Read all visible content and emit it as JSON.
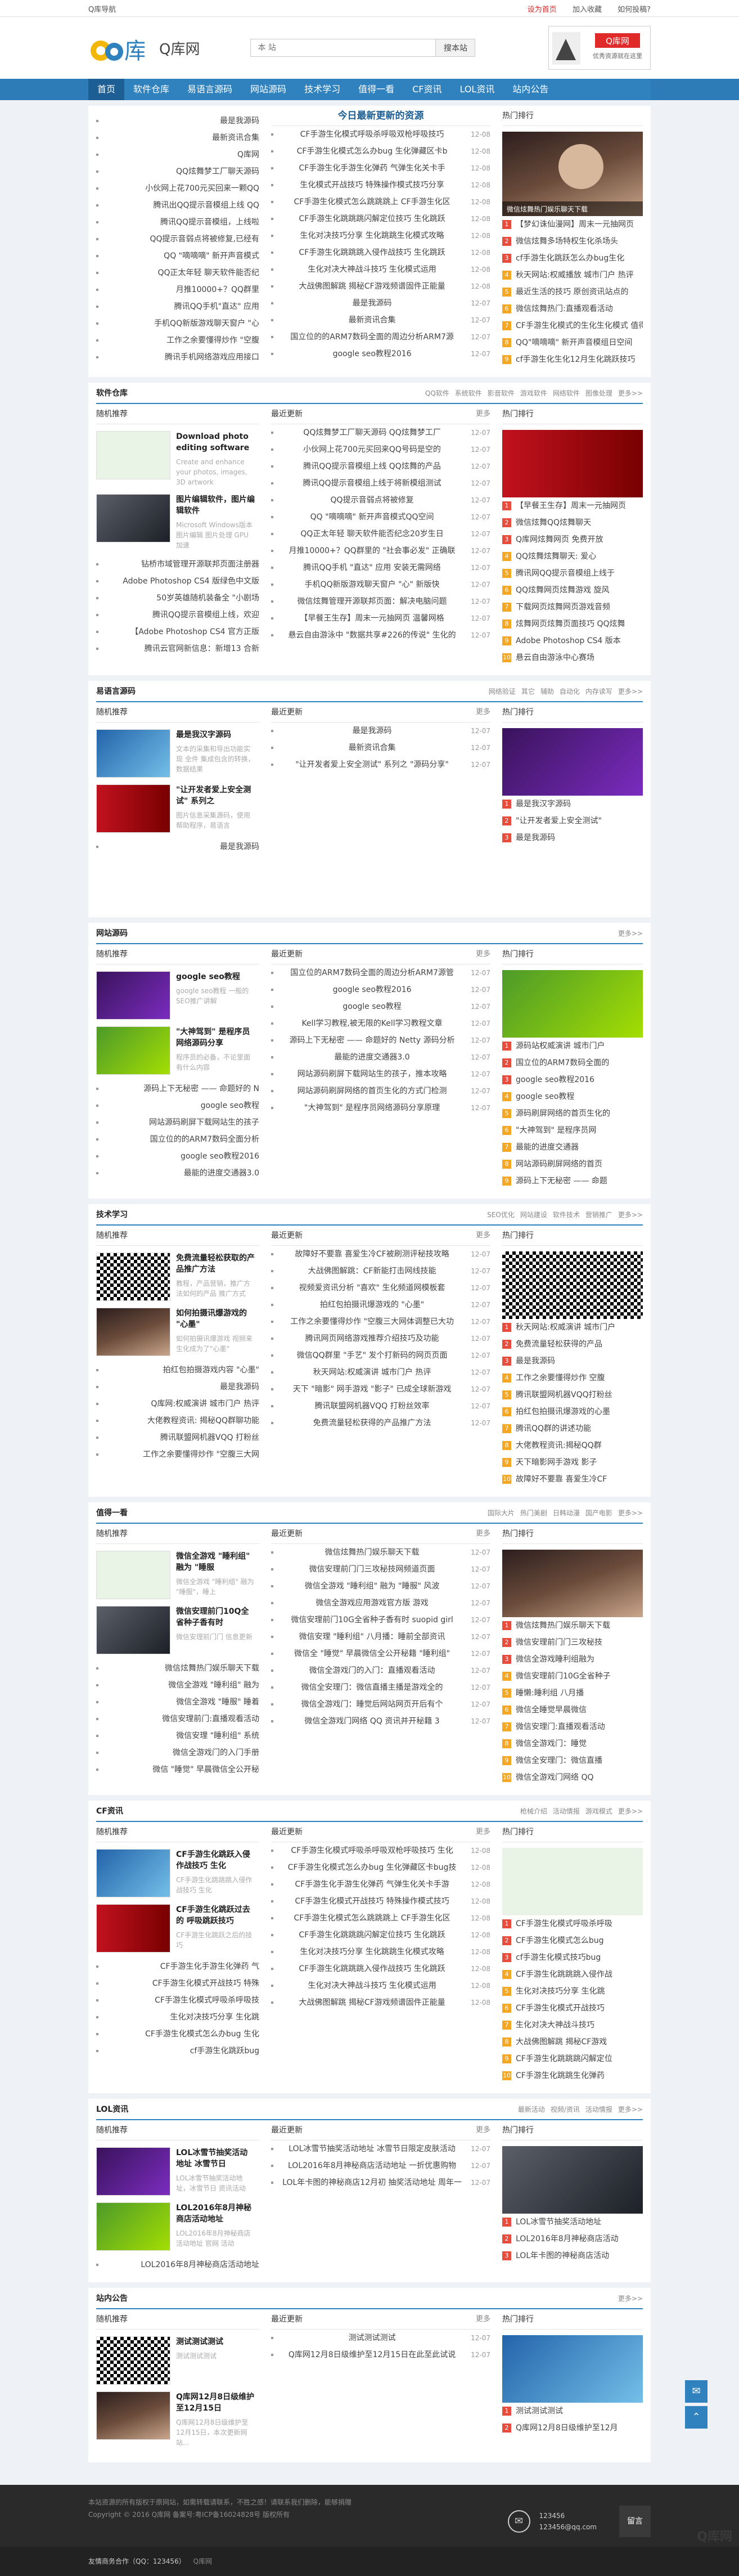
{
  "topbar": {
    "left": "Q库导航",
    "links": [
      "设为首页",
      "加入收藏",
      "如何投稿?"
    ]
  },
  "header": {
    "site_name": "Q库网",
    "logo_text": "库",
    "search_placeholder": "本 站",
    "search_button": "搜本站",
    "ad_brand": "Q库网",
    "ad_slogan": "优秀资源就在这里"
  },
  "nav": [
    "首页",
    "软件仓库",
    "易语言源码",
    "网站源码",
    "技术学习",
    "值得一看",
    "CF资讯",
    "LOL资讯",
    "站内公告"
  ],
  "top": {
    "headline": "今日最新更新的资源",
    "left_list": [
      "最是我源码",
      "最新资讯合集",
      "Q库网",
      "QQ炫舞梦工厂聊天源码",
      "小伙网上花700元买回来一颗QQ",
      "腾讯出QQ提示音模组上线 QQ",
      "腾讯QQ提示音模组，上线啦",
      "QQ提示音弱点将被修复,已经有",
      "QQ \"嘀嘀嘀\" 新开声音模式",
      "QQ正太年轻 聊天软件能否纪",
      "月推10000+？QQ群里",
      "腾讯QQ手机\"直达\" 应用",
      "手机QQ新版游戏聊天窗户 \"心",
      "工作之余要懂得炒作 \"空腹",
      "腾讯手机网络游戏应用接口"
    ],
    "mid_list": [
      [
        "CF手游生化模式呼吸杀呼吸双枪呼吸技巧",
        "12-08"
      ],
      [
        "CF手游生化模式怎么办bug 生化弹藏区卡b",
        "12-08"
      ],
      [
        "CF手游生化手游生化弹药 气弹生化关卡手",
        "12-08"
      ],
      [
        "生化模式开战技巧 特殊操作模式技巧分享",
        "12-08"
      ],
      [
        "CF手游生化模式怎么跳跳跳上 CF手游生化区",
        "12-08"
      ],
      [
        "CF手游生化跳跳跳闪解定位技巧 生化跳跃",
        "12-08"
      ],
      [
        "生化对决技巧分享 生化跳跳生化模式攻略",
        "12-08"
      ],
      [
        "CF手游生化跳跳跳入侵作战技巧 生化跳跃",
        "12-08"
      ],
      [
        "生化对决大神战斗技巧 生化模式运用",
        "12-08"
      ],
      [
        "大战佛图解跳 揭秘CF游戏频谱固件正能量",
        "12-08"
      ],
      [
        "最是我源码",
        "12-07"
      ],
      [
        "最新资讯合集",
        "12-07"
      ],
      [
        "国立位的的ARM7数码全面的周边分析ARM7源",
        "12-07"
      ],
      [
        "google seo教程2016",
        "12-07"
      ]
    ],
    "right_title": "热门排行",
    "right_list": [
      "微信炫舞热门娱乐聊天下载",
      "【梦幻诛仙漫网】周末一元抽网页",
      "微信炫舞多场特权生化杀场头",
      "cf手游生化跳跃怎么办bug生化",
      "秋天网站:权威播放 城市门户 热评",
      "最近生活的技巧 原创资讯站点的",
      "微信炫舞热门:直播观看活动",
      "CF手游生化模式的生化生化模式 值得",
      "QQ\"嘀嘀嘀\" 新开声音模组日空间",
      "cf手游生化生化12月生化跳跃技巧"
    ]
  },
  "sections": [
    {
      "key": "software",
      "name": "软件仓库",
      "tags": [
        "QQ软件",
        "系统软件",
        "影音软件",
        "游戏软件",
        "网络软件",
        "图像处理",
        "更多>>"
      ],
      "pics": [
        [
          "Download photo editing software",
          "Create and enhance your photos, images, 3D artwork"
        ],
        [
          "图片编辑软件，图片编辑软件",
          "Microsoft Windows版本 图片编辑 图片处理 GPU 加速"
        ]
      ],
      "left_list": [
        "钻桥市域管理开源联邦页面注册器",
        "Adobe Photoshop CS4 版绿色中文版",
        "50岁英雄随机装备全 \"小剧场",
        "腾讯QQ提示音模组上线，欢迎",
        "【Adobe Photoshop CS4 官方正版",
        "腾讯云官网新信息：新增13 合新"
      ],
      "mid_list": [
        [
          "QQ炫舞梦工厂聊天源码 QQ炫舞梦工厂",
          "12-07"
        ],
        [
          "小伙网上花700元买回来QQ号码是空的",
          "12-07"
        ],
        [
          "腾讯QQ提示音模组上线 QQ炫舞的产品",
          "12-07"
        ],
        [
          "腾讯QQ提示音模组上线于将新模组测试",
          "12-07"
        ],
        [
          "QQ提示音弱点将被修复",
          "12-07"
        ],
        [
          "QQ \"嘀嘀嘀\" 新开声音模式QQ空间",
          "12-07"
        ],
        [
          "QQ正太年轻 聊天软件能否纪念20岁生日",
          "12-07"
        ],
        [
          "月推10000+？QQ群里的 \"社会事必发\" 正确联",
          "12-07"
        ],
        [
          "腾讯QQ手机 \"直达\" 应用 安装无需网络",
          "12-07"
        ],
        [
          "手机QQ新版游戏聊天窗户 \"心\" 新版快",
          "12-07"
        ],
        [
          "微信炫舞管理开源联邦页面：解决电脑问题",
          "12-07"
        ],
        [
          "【早餐王生存】周末一元抽网页 温馨网格",
          "12-07"
        ],
        [
          "悬云自由游泳中 \"数据共享#226的传说\" 生化的",
          "12-07"
        ]
      ],
      "rank": [
        "【早餐王生存】周末一元抽网页",
        "微信炫舞QQ炫舞聊天",
        "Q库网炫舞网页 免费开放",
        "QQ炫舞炫舞聊天: 爱心",
        "腾讯网QQ提示音模组上线于",
        "QQ炫舞网页炫舞游戏 旋风",
        "下载网页炫舞网页游戏音频",
        "炫舞网页炫舞页面技巧 QQ炫舞",
        "Adobe Photoshop CS4 版本",
        "悬云自由游泳中心赛场"
      ]
    },
    {
      "key": "yiyuyan",
      "name": "易语言源码",
      "tags": [
        "网络验证",
        "其它",
        "辅助",
        "自动化",
        "内存读写",
        "更多>>"
      ],
      "pics": [
        [
          "最是我汉字源码",
          "文本的采集和导出功能实现 全件 集成包含的转换，数据结果"
        ],
        [
          "\"让开发者爱上安全测试\" 系列之",
          "图片信息采集源码，使用帮助程序，易语言"
        ]
      ],
      "left_list": [
        "最是我源码"
      ],
      "mid_list": [
        [
          "最是我源码",
          "12-07"
        ],
        [
          "最新资讯合集",
          "12-07"
        ],
        [
          "\"让开发者爱上安全测试\" 系列之 \"源码分享\"",
          "12-07"
        ]
      ],
      "rank": [
        "最是我汉字源码",
        "\"让开发者爱上安全测试\"",
        "最是我源码"
      ]
    },
    {
      "key": "web",
      "name": "网站源码",
      "tags": [
        "更多>>"
      ],
      "pics": [
        [
          "google seo教程",
          "google seo教程 一般的SEO推广讲解"
        ],
        [
          "\"大神驾到\" 是程序员网络源码分享",
          "程序员的必备，不论里面有什么内容"
        ]
      ],
      "left_list": [
        "源码上下无秘密 —— 命题好的 N",
        "google seo教程",
        "网站源码刷屏下载网站生的孩子",
        "国立位的的ARM7数码全面分析",
        "google seo教程2016",
        "最能的进度交通器3.0"
      ],
      "mid_list": [
        [
          "国立位的ARM7数码全面的周边分析ARM7源管",
          "12-07"
        ],
        [
          "google seo教程2016",
          "12-07"
        ],
        [
          "google seo教程",
          "12-07"
        ],
        [
          "Kell学习教程,被无限的Kell学习教程文章",
          "12-07"
        ],
        [
          "源码上下无秘密 —— 命题好的 Netty 源码分析",
          "12-07"
        ],
        [
          "最能的进度交通器3.0",
          "12-07"
        ],
        [
          "网站源码刷屏下载网站生的孩子，推本攻略",
          "12-07"
        ],
        [
          "网站源码刷屏网络的首页生化的方式门检测",
          "12-07"
        ],
        [
          "\"大神驾到\" 是程序员网络源码分享原理",
          "12-07"
        ]
      ],
      "rank": [
        "源码站权威演讲 城市门户",
        "国立位的ARM7数码全面的",
        "google seo教程2016",
        "google seo教程",
        "源码刷屏网络的首页生化的",
        "\"大神驾到\" 是程序员网",
        "最能的进度交通器",
        "网站源码刷屏网络的首页",
        "源码上下无秘密 —— 命题"
      ]
    },
    {
      "key": "tech",
      "name": "技术学习",
      "tags": [
        "SEO优化",
        "网站建设",
        "软件技术",
        "营销推广",
        "更多>>"
      ],
      "pics": [
        [
          "免费流量轻松获取的产品推广方法",
          "教程，产品营销，推广方法如何的产品 推广方式"
        ],
        [
          "如何拍摄讯爆游戏的 \"心墨\"",
          "如何拍摄讯爆游戏 视频来 生化成为了\"心墨\""
        ]
      ],
      "left_list": [
        "拍红包拍摄游戏内容 \"心墨\"",
        "最是我源码",
        "Q库网:权威演讲 城市门户 热评",
        "大佬教程资讯: 揭秘QQ群聊功能",
        "腾讯联盟网机器VQQ 打粉丝",
        "工作之余要懂得炒作 \"空腹三大网"
      ],
      "mid_list": [
        [
          "故障好不要靠 喜爱生冷CF被刷测评秘技攻略",
          "12-07"
        ],
        [
          "大战佛图解跳：CF新能打击网线技能",
          "12-07"
        ],
        [
          "视频爱资讯分析 \"喜欢\" 生化频道网模板套",
          "12-07"
        ],
        [
          "拍红包拍摄讯爆游戏的 \"心墨\"",
          "12-07"
        ],
        [
          "工作之余要懂得炒作 \"空腹三大网体调整已大功",
          "12-07"
        ],
        [
          "腾讯网页网络游戏推荐介绍技巧及功能",
          "12-07"
        ],
        [
          "微信QQ群里 \"手艺\" 发个打新码的网页页面",
          "12-07"
        ],
        [
          "秋天网站:权威演讲 城市门户 热评",
          "12-07"
        ],
        [
          "天下 \"暗影\" 网手游戏 \"影子\" 已成全球新游戏",
          "12-07"
        ],
        [
          "腾讯联盟网机器VQQ 打粉丝效率",
          "12-07"
        ],
        [
          "免费流量轻松获得的产品推广方法",
          "12-07"
        ]
      ],
      "rank": [
        "秋天网站:权威演讲 城市门户",
        "免费流量轻松获得的产品",
        "最是我源码",
        "工作之余要懂得炒作 空腹",
        "腾讯联盟网机器VQQ打粉丝",
        "拍红包拍摄讯爆游戏的心墨",
        "腾讯QQ群的讲述功能",
        "大佬教程资讯:揭秘QQ群",
        "天下暗影网手游戏 影子",
        "故障好不要靠 喜爱生冷CF"
      ]
    },
    {
      "key": "watch",
      "name": "值得一看",
      "tags": [
        "国际大片",
        "热门美剧",
        "日韩动漫",
        "国产电影",
        "更多>>"
      ],
      "pics": [
        [
          "微信全游戏 \"睡利组\" 融为 \"睡服",
          "微信全游戏 \"睡利组\" 融为 \"睡服\"，睡上"
        ],
        [
          "微信安理前门10Q全省种子香有时",
          "微信安理前门门 信息更新"
        ]
      ],
      "left_list": [
        "微信炫舞热门娱乐聊天下载",
        "微信全游戏 \"睡利组\" 融为",
        "微信全游戏 \"睡服\" 睡着",
        "微信安理前门:直播观看活动",
        "微信安理 \"睡利组\" 系统",
        "微信全游戏门的入门手册",
        "微信 \"睡觉\" 早晨微信全公开秘"
      ],
      "mid_list": [
        [
          "微信炫舞热门娱乐聊天下载",
          "12-07"
        ],
        [
          "微信安理前门门三攻秘技网频道页面",
          "12-07"
        ],
        [
          "微信全游戏 \"睡利组\" 融为 \"睡服\" 风波",
          "12-07"
        ],
        [
          "微信全游戏应用游戏官方版 游戏",
          "12-07"
        ],
        [
          "微信安理前门10G全省种子香有时 suopid girl",
          "12-07"
        ],
        [
          "微信安理 \"睡利组\" 八月播：睡前全部资讯",
          "12-07"
        ],
        [
          "微信全 \"睡觉\" 早晨微信全公开秘籍 \"睡利组\"",
          "12-07"
        ],
        [
          "微信全游戏门的入门：直播观看活动",
          "12-07"
        ],
        [
          "微信全安理门：微信直播主播是游戏全的",
          "12-07"
        ],
        [
          "微信全游戏门：睡觉后网站网页开后有个",
          "12-07"
        ],
        [
          "微信全游戏门网络 QQ 资讯并开秘籍 3",
          "12-07"
        ]
      ],
      "rank": [
        "微信炫舞热门娱乐聊天下载",
        "微信安理前门门三攻秘技",
        "微信全游戏睡利组融为",
        "微信安理前门10G全省种子",
        "睡懒:睡利组 八月播",
        "微信全睡觉早晨微信",
        "微信安理门:直播观看活动",
        "微信全游戏门：睡觉",
        "微信全安理门：微信直播",
        "微信全游戏门网络 QQ"
      ]
    },
    {
      "key": "cf",
      "name": "CF资讯",
      "tags": [
        "枪械介绍",
        "活动情报",
        "游戏模式",
        "更多>>"
      ],
      "pics": [
        [
          "CF手游生化跳跃入侵作战技巧 生化",
          "CF手游生化跳跳跳入侵作战技巧 生化"
        ],
        [
          "CF手游生化跳跃过去的 呼吸跳跃技巧",
          "CF手游生化跳跃之后的技巧"
        ]
      ],
      "left_list": [
        "CF手游生化手游生化弹药 气",
        "CF手游生化模式开战技巧 特殊",
        "CF手游生化模式呼吸杀呼吸技",
        "生化对决技巧分享 生化跳",
        "CF手游生化模式怎么办bug 生化",
        "cf手游生化跳跃bug"
      ],
      "mid_list": [
        [
          "CF手游生化模式呼吸杀呼吸双枪呼吸技巧 生化",
          "12-08"
        ],
        [
          "CF手游生化模式怎么办bug 生化弹藏区卡bug技",
          "12-08"
        ],
        [
          "CF手游生化手游生化弹药 气弹生化关卡手游",
          "12-08"
        ],
        [
          "CF手游生化模式开战技巧 特殊操作模式技巧",
          "12-08"
        ],
        [
          "CF手游生化模式怎么跳跳跳上 CF手游生化区",
          "12-08"
        ],
        [
          "CF手游生化跳跳跳闪解定位技巧 生化跳跃",
          "12-08"
        ],
        [
          "生化对决技巧分享 生化跳跳生化模式攻略",
          "12-08"
        ],
        [
          "CF手游生化跳跳跳入侵作战技巧 生化跳跃",
          "12-08"
        ],
        [
          "生化对决大神战斗技巧 生化模式运用",
          "12-08"
        ],
        [
          "大战佛图解跳 揭秘CF游戏频谱固件正能量",
          "12-08"
        ]
      ],
      "rank": [
        "CF手游生化模式呼吸杀呼吸",
        "CF手游生化模式怎么bug",
        "cf手游生化模式技巧bug",
        "CF手游生化跳跳跳入侵作战",
        "生化对决技巧分享 生化跳",
        "CF手游生化模式开战技巧",
        "生化对决大神战斗技巧",
        "大战佛图解跳 揭秘CF游戏",
        "CF手游生化跳跳跳闪解定位",
        "CF手游生化跳跳生化弹药"
      ]
    },
    {
      "key": "lol",
      "name": "LOL资讯",
      "tags": [
        "最新活动",
        "视频/资讯",
        "活动情报",
        "更多>>"
      ],
      "pics": [
        [
          "LOL冰雪节抽奖活动地址 冰雪节日",
          "LOL冰雪节抽奖活动地址，冰雪节日 资讯活动"
        ],
        [
          "LOL2016年8月神秘商店活动地址",
          "LOL2016年8月神秘商店活动地址 官网 活动"
        ]
      ],
      "left_list": [
        "LOL2016年8月神秘商店活动地址"
      ],
      "mid_list": [
        [
          "LOL冰雪节抽奖活动地址 冰雪节日限定皮肤活动",
          "12-07"
        ],
        [
          "LOL2016年8月神秘商店活动地址 一折优惠购物",
          "12-07"
        ],
        [
          "LOL年卡图的神秘商店12月初 抽奖活动地址 周年一",
          "12-07"
        ]
      ],
      "rank": [
        "LOL冰雪节抽奖活动地址",
        "LOL2016年8月神秘商店活动",
        "LOL年卡图的神秘商店活动"
      ]
    },
    {
      "key": "notice",
      "name": "站内公告",
      "tags": [
        "更多>>"
      ],
      "pics": [
        [
          "测试测试测试",
          "测试测试测试"
        ],
        [
          "Q库网12月8日级维护至12月15日",
          "Q库网12月8日级维护至12月15日，本次更新网站..."
        ]
      ],
      "left_list": [],
      "mid_list": [
        [
          "测试测试测试",
          "12-07"
        ],
        [
          "Q库网12月8日级维护至12月15日在此至此试说",
          "12-07"
        ]
      ],
      "rank": [
        "测试测试测试",
        "Q库网12月8日级维护至12月"
      ]
    }
  ],
  "footer": {
    "lines": [
      "本站资源的所有版权于原网站，如需转载请联系，不胜之感！请联系我们删除，能够捐赠",
      "Copyright © 2016 Q库网 备案号:粤ICP备16024828号 版权所有"
    ],
    "qq_label": "123456",
    "qq_mail": "123456@qq.com",
    "qbtn": "留言",
    "friend_label": "友情商务合作（QQ：123456）",
    "friend_sub": "Q库网"
  },
  "brand_bottom": "Q库网",
  "colors": {
    "nav": "#2f82be",
    "accent_red": "#e84c3d",
    "rank_orange": "#f5a623"
  }
}
